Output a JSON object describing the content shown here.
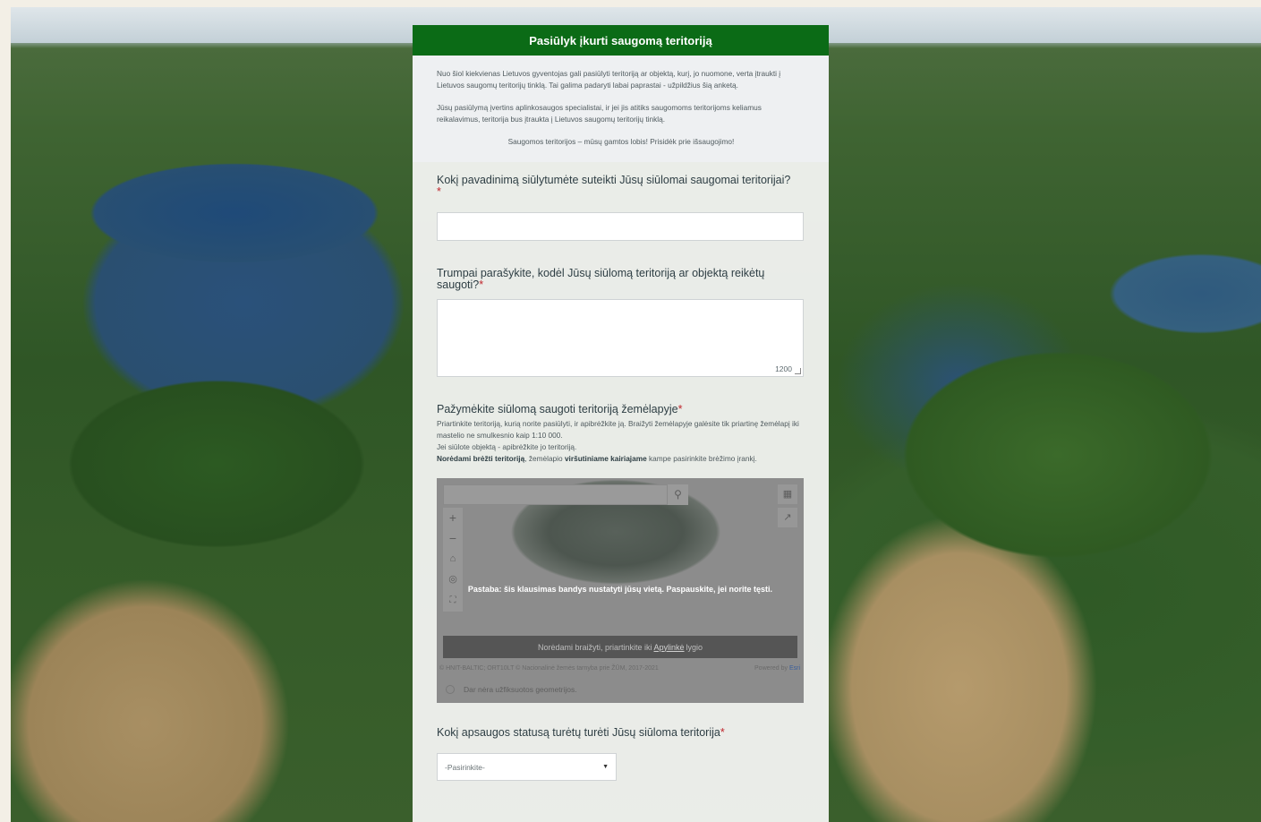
{
  "form": {
    "title": "Pasiūlyk įkurti saugomą teritoriją",
    "intro": {
      "p1": "Nuo šiol kiekvienas Lietuvos gyventojas gali pasiūlyti teritoriją ar objektą, kurį, jo nuomone, verta įtraukti į Lietuvos saugomų teritorijų tinklą. Tai galima padaryti labai paprastai - užpildžius šią anketą.",
      "p2": "Jūsų pasiūlymą įvertins aplinkosaugos specialistai, ir jei jis atitiks saugomoms teritorijoms keliamus reikalavimus, teritorija bus įtraukta į Lietuvos saugomų teritorijų tinklą.",
      "p3": "Saugomos teritorijos – mūsų gamtos lobis! Prisidėk prie išsaugojimo!"
    },
    "required_mark": "*",
    "q1": {
      "label": "Kokį pavadinimą siūlytumėte suteikti Jūsų siūlomai saugomai teritorijai?",
      "value": ""
    },
    "q2": {
      "label": "Trumpai parašykite, kodėl Jūsų siūlomą teritoriją ar objektą reikėtų saugoti?",
      "value": "",
      "char_count": "1200"
    },
    "q3": {
      "label": "Pažymėkite siūlomą saugoti teritoriją žemėlapyje",
      "help_line1": "Priartinkite teritoriją, kurią norite pasiūlyti, ir apibrėžkite ją. Braižyti žemėlapyje galėsite tik priartinę žemėlapį iki mastelio ne smulkesnio kaip 1:10 000.",
      "help_line2": "Jei siūlote objektą - apibrėžkite jo teritoriją.",
      "help_line3_bold": "Norėdami brėžti teritoriją",
      "help_line3_a": ", žemėlapio ",
      "help_line3_bold2": "viršutiniame kairiajame",
      "help_line3_b": " kampe pasirinkite brėžimo įrankį."
    },
    "map": {
      "search_value": "",
      "note": "Pastaba: šis klausimas bandys nustatyti jūsų vietą. Paspauskite, jei norite tęsti.",
      "draw_prefix": "Norėdami braižyti, priartinkite iki",
      "draw_link": "Apylinkė",
      "draw_suffix": "lygio",
      "attribution": "© HNIT-BALTIC; ORT10LT © Nacionalinė žemės tarnyba prie ŽŪM, 2017-2021",
      "powered_by": "Powered by",
      "esri": "Esri",
      "geometry_status": "Dar nėra užfiksuotos geometrijos."
    },
    "q4": {
      "label": "Kokį apsaugos statusą turėtų turėti Jūsų siūloma teritorija",
      "select_value": "-Pasirinkite-"
    }
  }
}
